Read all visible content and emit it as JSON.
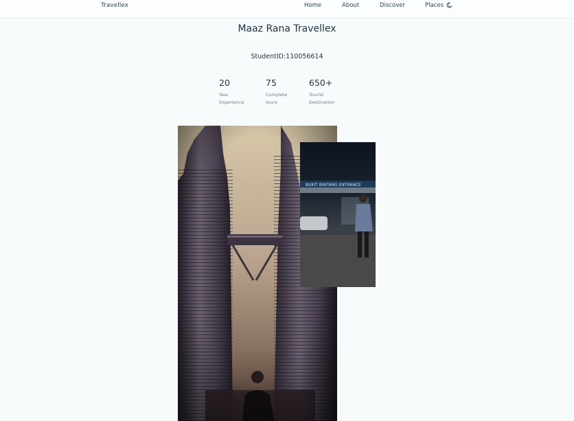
{
  "header": {
    "logo": "Travellex",
    "nav": [
      "Home",
      "About",
      "Discover",
      "Places"
    ],
    "theme_icon": "moon-icon"
  },
  "hero": {
    "title": "Maaz Rana Travellex",
    "student_id": "StudentID:110056614"
  },
  "stats": [
    {
      "value": "20",
      "label": "Year\nExperience"
    },
    {
      "value": "75",
      "label": "Complete\ntours"
    },
    {
      "value": "650+",
      "label": "Tourist\nDestination"
    }
  ],
  "images": {
    "main": {
      "subject": "petronas-twin-towers-photo"
    },
    "overlay": {
      "sign_text": "BUKIT BINTANG ENTRANCE"
    }
  }
}
